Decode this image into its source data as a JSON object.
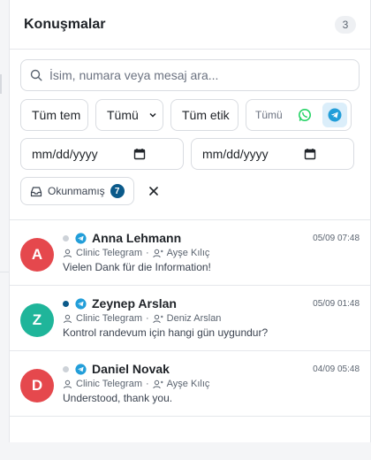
{
  "header": {
    "title": "Konuşmalar",
    "count": "3"
  },
  "search": {
    "placeholder": "İsim, numara veya mesaj ara..."
  },
  "filters": {
    "team": "Tüm tem",
    "status": "Tümü",
    "tags": "Tüm etik",
    "channel_label": "Tümü",
    "date_from": "mm/dd/yyyy",
    "date_to": "mm/dd/yyyy",
    "unread_label": "Okunmamış",
    "unread_count": "7"
  },
  "colors": {
    "telegram": "#229ED9",
    "whatsapp": "#25D366",
    "accent": "#0b5a8a"
  },
  "conversations": [
    {
      "initial": "A",
      "name": "Anna Lehmann",
      "time": "05/09 07:48",
      "account": "Clinic Telegram",
      "agent": "Ayşe Kılıç",
      "message": "Vielen Dank für die Information!",
      "avatar_color": "#e5484d",
      "unread": false
    },
    {
      "initial": "Z",
      "name": "Zeynep Arslan",
      "time": "05/09 01:48",
      "account": "Clinic Telegram",
      "agent": "Deniz Arslan",
      "message": "Kontrol randevum için hangi gün uygundur?",
      "avatar_color": "#1fb59a",
      "unread": true
    },
    {
      "initial": "D",
      "name": "Daniel Novak",
      "time": "04/09 05:48",
      "account": "Clinic Telegram",
      "agent": "Ayşe Kılıç",
      "message": "Understood, thank you.",
      "avatar_color": "#e5484d",
      "unread": false
    }
  ]
}
